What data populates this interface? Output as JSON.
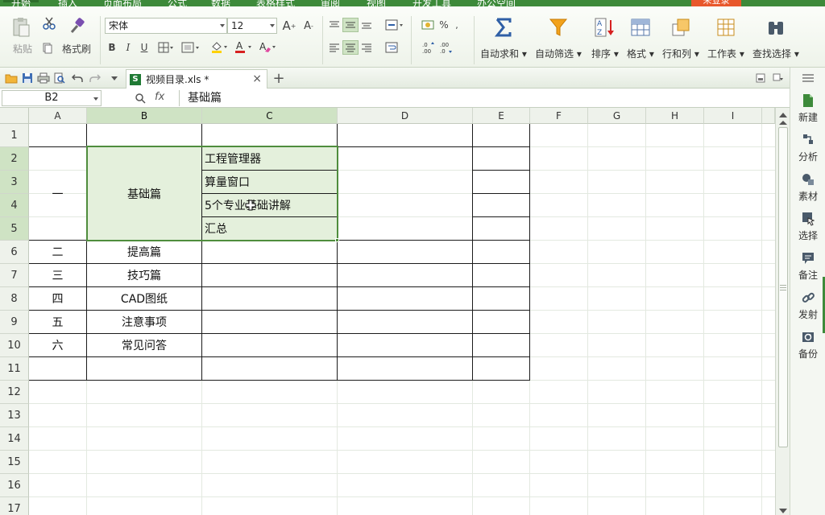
{
  "menu": {
    "items": [
      "开始",
      "插入",
      "页面布局",
      "公式",
      "数据",
      "表格样式",
      "审阅",
      "视图",
      "开发工具",
      "办公空间"
    ],
    "login": "未登录"
  },
  "ribbon": {
    "paste": "粘贴",
    "format_painter": "格式刷",
    "font_name": "宋体",
    "font_size": "12",
    "bold": "B",
    "italic": "I",
    "underline": "U",
    "percent": "%",
    "autosum": "自动求和",
    "autofilter": "自动筛选",
    "sort": "排序",
    "format": "格式",
    "rows_cols": "行和列",
    "worksheet": "工作表",
    "find_select": "查找选择"
  },
  "tabs": {
    "doc_name": "视频目录.xls *",
    "close": "×",
    "new_tab": "+"
  },
  "formula_bar": {
    "name_box": "B2",
    "fx": "fx",
    "value": "基础篇"
  },
  "columns": [
    "A",
    "B",
    "C",
    "D",
    "E",
    "F",
    "G",
    "H",
    "I"
  ],
  "rows": [
    "1",
    "2",
    "3",
    "4",
    "5",
    "6",
    "7",
    "8",
    "9",
    "10",
    "11",
    "12",
    "13",
    "14",
    "15",
    "16",
    "17"
  ],
  "cells": {
    "A2": "一",
    "B2": "基础篇",
    "C2": "工程管理器",
    "C3": "算量窗口",
    "C4": "5个专业基础讲解",
    "C5": "汇总",
    "A6": "二",
    "B6": "提高篇",
    "A7": "三",
    "B7": "技巧篇",
    "A8": "四",
    "B8": "CAD图纸",
    "A9": "五",
    "B9": "注意事项",
    "A10": "六",
    "B10": "常见问答"
  },
  "sidebar": {
    "items": [
      "新建",
      "分析",
      "素材",
      "选择",
      "备注",
      "发射",
      "备份"
    ]
  },
  "colors": {
    "accent": "#3d8a3a",
    "selection_border": "#4f8d3d",
    "selection_fill": "#e4f0dc",
    "header_selected": "#cfe3c4"
  }
}
